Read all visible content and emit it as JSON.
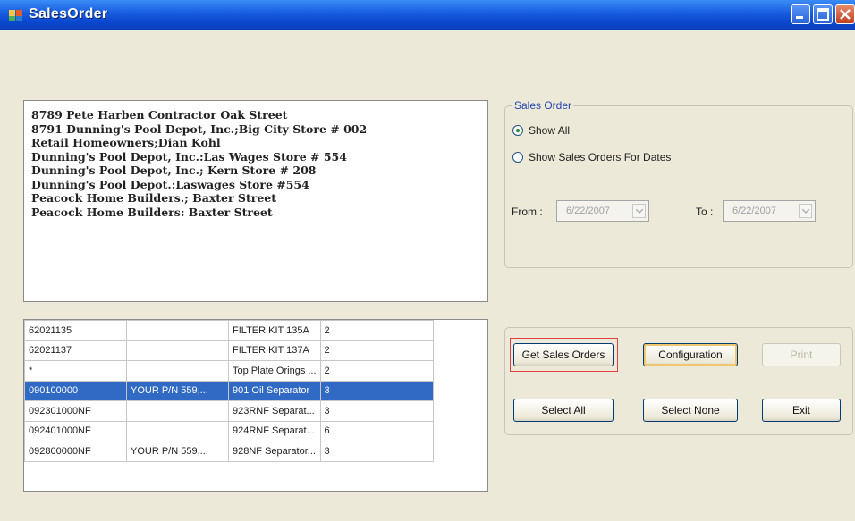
{
  "window": {
    "title": "SalesOrder"
  },
  "customers": [
    "8789  Pete Harben Contractor Oak Street",
    "8791  Dunning's Pool Depot, Inc.;Big City Store # 002",
    "Retail Homeowners;Dian Kohl",
    "Dunning's Pool Depot, Inc.:Las Wages Store # 554",
    "Dunning's Pool Depot, Inc.; Kern Store # 208",
    "Dunning's Pool Depot.:Laswages Store #554",
    "Peacock Home Builders.; Baxter Street",
    "Peacock Home Builders: Baxter Street"
  ],
  "order_rows": [
    [
      "62021135",
      "",
      "FILTER KIT 135A",
      "2",
      false
    ],
    [
      "62021137",
      "",
      "FILTER KIT 137A",
      "2",
      false
    ],
    [
      "*",
      "",
      "Top Plate Orings ...",
      "2",
      false
    ],
    [
      "090100000",
      "YOUR P/N 559,...",
      "901 Oil Separator",
      "3",
      true
    ],
    [
      "092301000NF",
      "",
      "923RNF Separat...",
      "3",
      false
    ],
    [
      "092401000NF",
      "",
      "924RNF Separat...",
      "6",
      false
    ],
    [
      "092800000NF",
      "YOUR P/N 559,...",
      "928NF Separator...",
      "3",
      false
    ]
  ],
  "sales_order": {
    "group_label": "Sales Order",
    "show_all_label": "Show All",
    "show_all_selected": true,
    "show_for_dates_label": "Show Sales Orders For Dates",
    "from_label": "From :",
    "from_value": "6/22/2007",
    "to_label": "To :",
    "to_value": "6/22/2007"
  },
  "buttons": {
    "get_sales_orders": "Get Sales Orders",
    "configuration": "Configuration",
    "print": "Print",
    "select_all": "Select All",
    "select_none": "Select None",
    "exit": "Exit"
  },
  "colors": {
    "title_bar": "#0b49d0",
    "selection": "#316ac5",
    "highlight_frame": "#e04040"
  }
}
